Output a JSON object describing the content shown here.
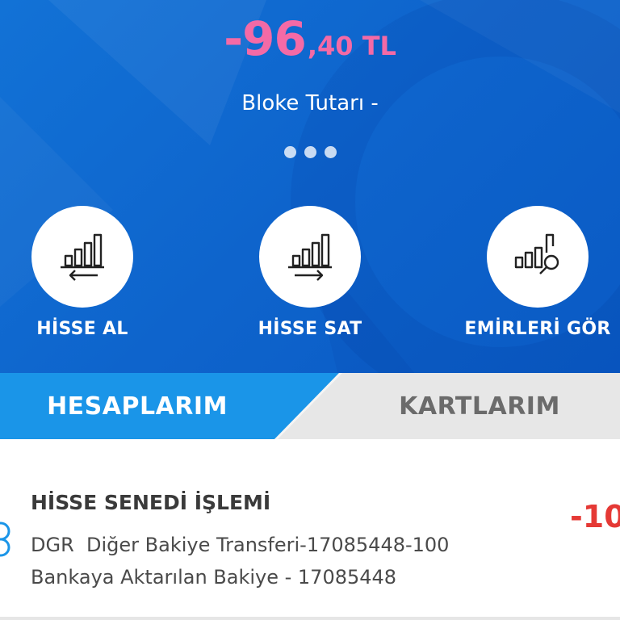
{
  "balance": {
    "integer": "-96",
    "fraction": ",40 TL",
    "color": "#f46aa6"
  },
  "bloke": {
    "label": "Bloke Tutarı -"
  },
  "pager": {
    "count": 3,
    "active": 0
  },
  "actions": [
    {
      "label": "HİSSE AL",
      "icon": "stock-buy-icon"
    },
    {
      "label": "HİSSE SAT",
      "icon": "stock-sell-icon"
    },
    {
      "label": "EMİRLERİ GÖR",
      "icon": "orders-search-icon"
    }
  ],
  "tabs": {
    "active": "HESAPLARIM",
    "inactive": "KARTLARIM",
    "active_color": "#1a95e8",
    "inactive_color": "#e7e7e7"
  },
  "transaction": {
    "title": "HİSSE SENEDİ İŞLEMİ",
    "line1": "DGR  Diğer Bakiye Transferi-17085448-100",
    "line2": "Bankaya Aktarılan Bakiye - 17085448",
    "amount": "-10",
    "amount_color": "#e53935"
  },
  "theme": {
    "primary": "#0e64cc"
  }
}
